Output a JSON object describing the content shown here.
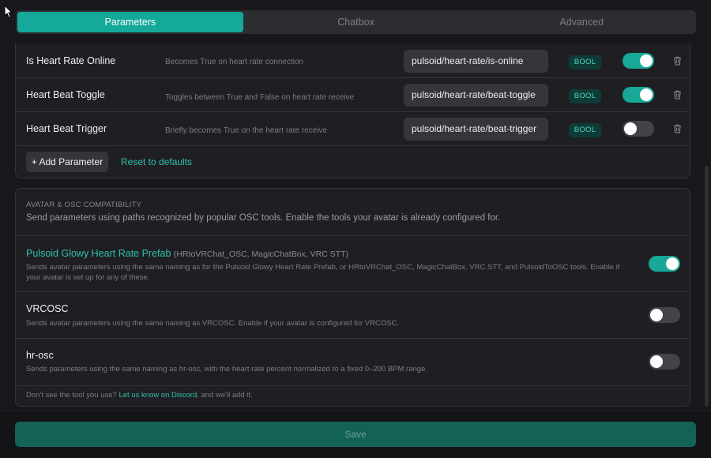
{
  "tabs": [
    {
      "label": "Parameters",
      "active": true
    },
    {
      "label": "Chatbox",
      "active": false
    },
    {
      "label": "Advanced",
      "active": false
    }
  ],
  "parameters": [
    {
      "name": "Is Heart Rate Online",
      "description": "Becomes True on heart rate connection",
      "path": "pulsoid/heart-rate/is-online",
      "type": "BOOL",
      "enabled": true
    },
    {
      "name": "Heart Beat Toggle",
      "description": "Toggles between True and False on heart rate receive",
      "path": "pulsoid/heart-rate/beat-toggle",
      "type": "BOOL",
      "enabled": true
    },
    {
      "name": "Heart Beat Trigger",
      "description": "Briefly becomes True on the heart rate receive",
      "path": "pulsoid/heart-rate/beat-trigger",
      "type": "BOOL",
      "enabled": false
    }
  ],
  "actions": {
    "add_label": "+ Add Parameter",
    "reset_label": "Reset to defaults"
  },
  "compat": {
    "title": "AVATAR & OSC COMPATIBILITY",
    "subtitle": "Send parameters using paths recognized by popular OSC tools. Enable the tools your avatar is already configured for.",
    "items": [
      {
        "name": "Pulsoid Glowy Heart Rate Prefab",
        "aliases": "(HRtoVRChat_OSC, MagicChatBox, VRC STT)",
        "description": "Sends avatar parameters using the same naming as for the Pulsoid Glowy Heart Rate Prefab, or HRtoVRChat_OSC, MagicChatBox, VRC STT, and PulsoidToOSC tools. Enable if your avatar is set up for any of these.",
        "enabled": true
      },
      {
        "name": "VRCOSC",
        "description": "Sends avatar parameters using the same naming as VRCOSC. Enable if your avatar is configured for VRCOSC.",
        "enabled": false
      },
      {
        "name": "hr-osc",
        "description": "Sends parameters using the same naming as hr-osc, with the heart rate percent normalized to a fixed 0–200 BPM range.",
        "enabled": false
      }
    ],
    "footer_before": "Don't see the tool you use?",
    "footer_link": "Let us know on Discord",
    "footer_after": ", and we'll add it."
  },
  "save_label": "Save",
  "colors": {
    "accent": "#15a99a",
    "background": "#18181c",
    "panel": "#1f1f23"
  }
}
